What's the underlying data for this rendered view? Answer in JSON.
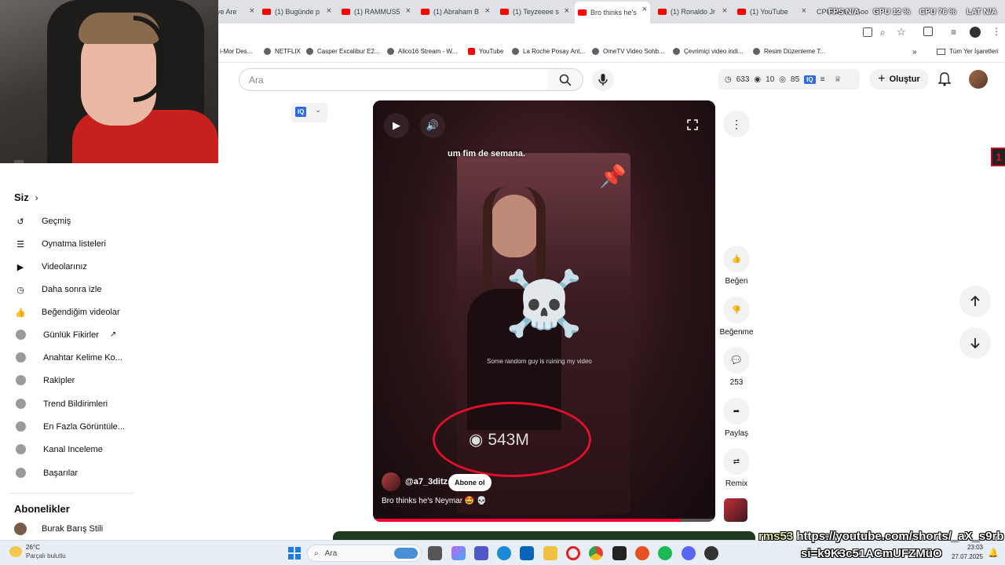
{
  "browser": {
    "tabs": [
      {
        "label": "ve Are"
      },
      {
        "label": "(1) Bugünde p"
      },
      {
        "label": "(1) RAMMUS5"
      },
      {
        "label": "(1) Abraham B"
      },
      {
        "label": "(1) Teyzeeee s"
      },
      {
        "label": "Bro thinks he's"
      },
      {
        "label": "(1) Ronaldo Jr"
      },
      {
        "label": "(1) YouTube"
      },
      {
        "label": "CPU/GPU - Goo"
      }
    ],
    "bookmarks": [
      {
        "label": "i-Mor Des..."
      },
      {
        "label": "NETFLIX"
      },
      {
        "label": "Casper Excalibur E2..."
      },
      {
        "label": "Alico16 Stream - W..."
      },
      {
        "label": "YouTube"
      },
      {
        "label": "La Roche Posay Ant..."
      },
      {
        "label": "OmeTV Video Sohb..."
      },
      {
        "label": "Çevrimiçi video indi..."
      },
      {
        "label": "Resim Düzenleme T..."
      }
    ],
    "all_bookmarks": "Tüm Yer İşaretleri"
  },
  "osd": {
    "fps_label": "FPS",
    "fps_value": "N/A",
    "gpu_label": "GPU",
    "gpu_value": "12 %",
    "cpu_label": "CPU",
    "cpu_value": "76 %",
    "lat_label": "LAT",
    "lat_value": "N/A"
  },
  "header": {
    "search_placeholder": "Ara",
    "stats": {
      "views": "633",
      "eye": "10",
      "watch": "85"
    },
    "iq_badge": "IQ",
    "create_label": "Oluştur"
  },
  "sidebar": {
    "you_label": "Siz",
    "items": [
      {
        "label": "Geçmiş"
      },
      {
        "label": "Oynatma listeleri"
      },
      {
        "label": "Videolarınız"
      },
      {
        "label": "Daha sonra izle"
      },
      {
        "label": "Beğendiğim videolar"
      },
      {
        "label": "Günlük Fikirler"
      },
      {
        "label": "Anahtar Kelime Ko..."
      },
      {
        "label": "Rakipler"
      },
      {
        "label": "Trend Bildirimleri"
      },
      {
        "label": "En Fazla Görüntüle..."
      },
      {
        "label": "Kanal Inceleme"
      },
      {
        "label": "Başarılar"
      }
    ],
    "subs_label": "Abonelikler",
    "subs": [
      {
        "label": "Burak Barış Stili"
      }
    ]
  },
  "short": {
    "caption_top": "um fim de semana.",
    "overlay_text": "Some random guy is ruining my video",
    "views_overlay": "543M",
    "channel": "@a7_3ditz",
    "subscribe_label": "Abone ol",
    "title": "Bro thinks he's Neymar 🤩 💀",
    "progress": 0.9
  },
  "actions": {
    "like_label": "Beğen",
    "dislike_label": "Beğenme",
    "comments_count": "253",
    "share_label": "Paylaş",
    "remix_label": "Remix"
  },
  "side_badge": "1",
  "stream_overlay": {
    "name": "rms53",
    "url_line1": "https://youtube.com/shorts/_aX_s9rb",
    "url_line2": "si=k9K3c51ACmUFZMüO"
  },
  "taskbar": {
    "weather_temp": "26°C",
    "weather_desc": "Parçalı bulutlu",
    "search_label": "Ara",
    "time": "23:03",
    "date": "27.07.2025"
  },
  "colors": {
    "accent": "#ff0000",
    "circle": "#e0102a",
    "taskbar": "#e8eef5"
  }
}
